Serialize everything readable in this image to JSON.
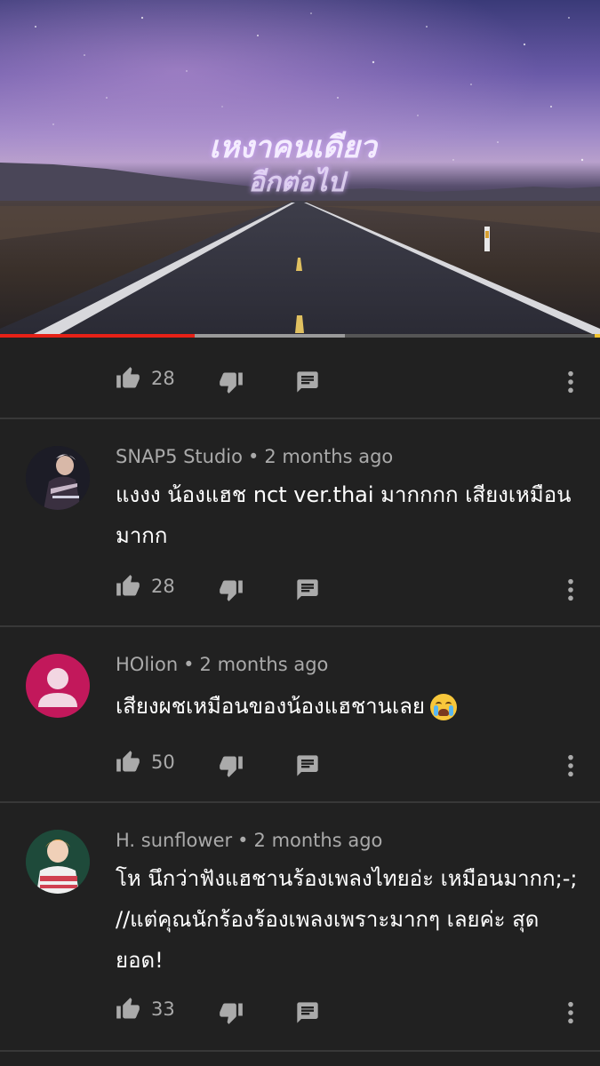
{
  "video": {
    "overlay_line1": "เหงาคนเดียว",
    "overlay_line2": "อีกต่อไป",
    "progress_played": 0.325,
    "progress_buffered": 0.575
  },
  "top_actions": {
    "like_count": "28"
  },
  "comments": [
    {
      "author": "SNAP5 Studio",
      "separator": "•",
      "time": "2 months ago",
      "text": "แงงง น้องแฮช nct ver.thai มากกกก เสียงเหมือนมากก",
      "like_count": "28"
    },
    {
      "author": "HOlion",
      "separator": "•",
      "time": "2 months ago",
      "text": "เสียงผชเหมือนของน้องแฮชานเลย",
      "emoji": "loudly-crying-face",
      "like_count": "50"
    },
    {
      "author": "H. sunflower",
      "separator": "•",
      "time": "2 months ago",
      "text": "โห นึกว่าฟังแฮชานร้องเพลงไทยอ่ะ เหมือนมากก;-; //แต่คุณนักร้องร้องเพลงเพราะมากๆ เลยค่ะ สุดยอด!",
      "like_count": "33"
    }
  ],
  "icons": {
    "like": "thumb-up-icon",
    "dislike": "thumb-down-icon",
    "reply": "reply-comment-icon",
    "more": "more-vertical-icon"
  },
  "colors": {
    "background": "#212121",
    "divider": "#383838",
    "progress_played": "#e62117",
    "meta_text": "#aaaaaa",
    "default_avatar": "#c2185b"
  }
}
